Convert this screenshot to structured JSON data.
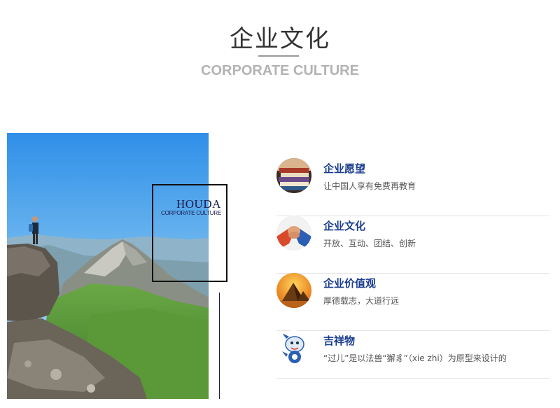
{
  "header": {
    "title": "企业文化",
    "subtitle": "CORPORATE CULTURE"
  },
  "photo": {
    "brand_name": "HOUDA",
    "brand_subtitle": "CORPORATE CULTURE"
  },
  "culture_items": [
    {
      "name": "企业愿望",
      "desc": "让中国人享有免费再教育",
      "icon": "books-icon"
    },
    {
      "name": "企业文化",
      "desc": "开放、互动、团结、创新",
      "icon": "handshake-icon"
    },
    {
      "name": "企业价值观",
      "desc": "厚德载志，大道行远",
      "icon": "pyramid-icon"
    },
    {
      "name": "吉祥物",
      "desc": "“过儿”是以法兽“獬豸”（xie zhi）为原型来设计的",
      "icon": "mascot-icon"
    }
  ],
  "colors": {
    "accent": "#1b3d8f",
    "title": "#333333",
    "subtitle": "#b3b3b3",
    "divider": "#e3e3e3"
  }
}
